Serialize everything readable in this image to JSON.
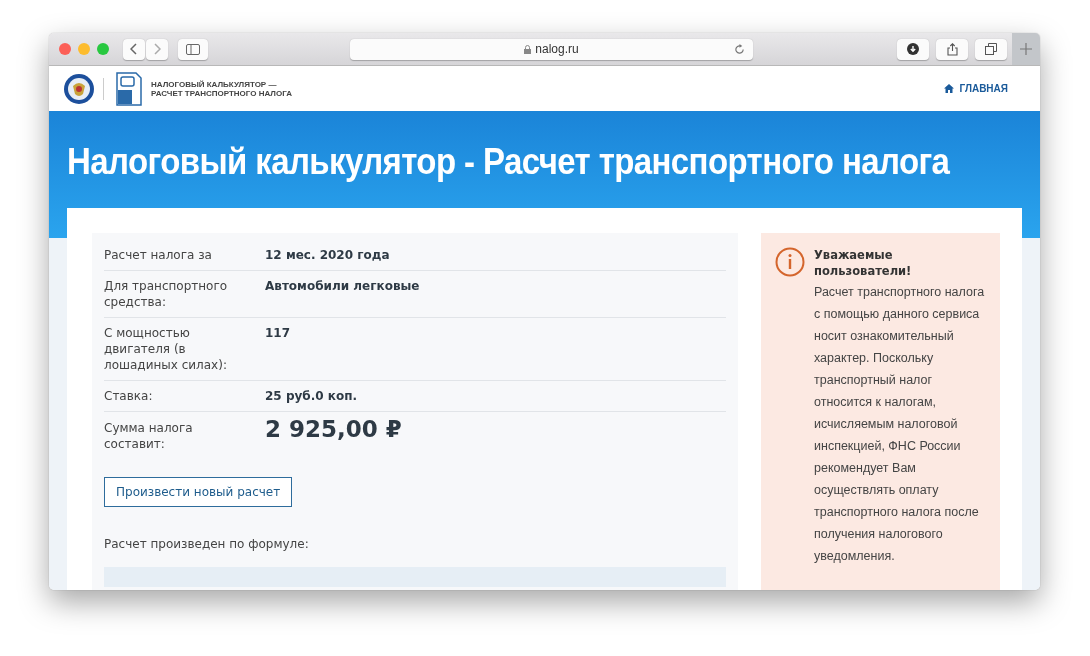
{
  "browser": {
    "url": "nalog.ru"
  },
  "site_header": {
    "logo_text": [
      "НАЛОГОВЫЙ КАЛЬКУЛЯТОР —",
      "РАСЧЕТ ТРАНСПОРТНОГО НАЛОГА"
    ],
    "nav_link": "ГЛАВНАЯ"
  },
  "banner": {
    "title": "Налоговый калькулятор - Расчет транспортного налога"
  },
  "result_rows": [
    {
      "kind": "plain",
      "label": "Расчет налога за",
      "value": "12 мес. 2020 года"
    },
    {
      "kind": "plain",
      "label": "Для транспортного средства:",
      "value": "Автомобили легковые"
    },
    {
      "kind": "plain",
      "label": "С мощностью двигателя (в лошадиных силах):",
      "value": "117"
    },
    {
      "kind": "plain",
      "label": "Ставка:",
      "value": "25 руб.0 коп."
    },
    {
      "kind": "total",
      "label": "Сумма налога составит:",
      "value": "2 925,00 ₽"
    }
  ],
  "new_calc_button": "Произвести новый расчет",
  "formula_label": "Расчет произведен по формуле:",
  "notice": {
    "title": "Уважаемые пользователи!",
    "body": "Расчет транспортного налога с помощью данного сервиса носит ознакомительный характер. Поскольку транспортный налог относится к налогам, исчисляемым налоговой инспекцией, ФНС России рекомендует Вам осуществлять оплату транспортного налога после получения налогового уведомления."
  }
}
